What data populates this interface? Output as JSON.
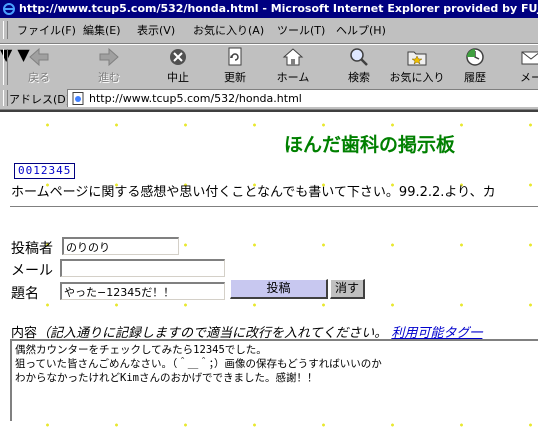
{
  "window": {
    "title": "http://www.tcup5.com/532/honda.html - Microsoft Internet Explorer provided by FUJITSU"
  },
  "menu": {
    "items": [
      "ファイル(F)",
      "編集(E)",
      "表示(V)",
      "お気に入り(A)",
      "ツール(T)",
      "ヘルプ(H)"
    ]
  },
  "toolbar": {
    "back": "戻る",
    "forward": "進む",
    "stop": "中止",
    "refresh": "更新",
    "home": "ホーム",
    "search": "検索",
    "favorites": "お気に入り",
    "history": "履歴",
    "mail": "メー"
  },
  "address": {
    "label": "アドレス(D)",
    "url": "http://www.tcup5.com/532/honda.html"
  },
  "page": {
    "title": "ほんだ歯科の掲示板",
    "counter": "0012345",
    "intro": "ホームページに関する感想や思い付くことなんでも書いて下さい。99.2.2.より、カ"
  },
  "form": {
    "author_label": "投稿者",
    "author_value": "のりのり",
    "mail_label": "メール",
    "mail_value": "",
    "subject_label": "題名",
    "subject_value": "やった−12345だ！！",
    "submit_label": "投稿",
    "clear_label": "消す",
    "content_label": "内容",
    "content_hint": "（記入通りに記録しますので適当に改行を入れてください。",
    "tags_link": "利用可能タグ一",
    "message_lines": [
      "偶然カウンターをチェックしてみたら12345でした。",
      "狙っていた皆さんごめんなさい。（＾＿＾；）画像の保存もどうすればいいのか",
      "わからなかったけれどKimさんのおかげでできました。感謝！！"
    ]
  }
}
